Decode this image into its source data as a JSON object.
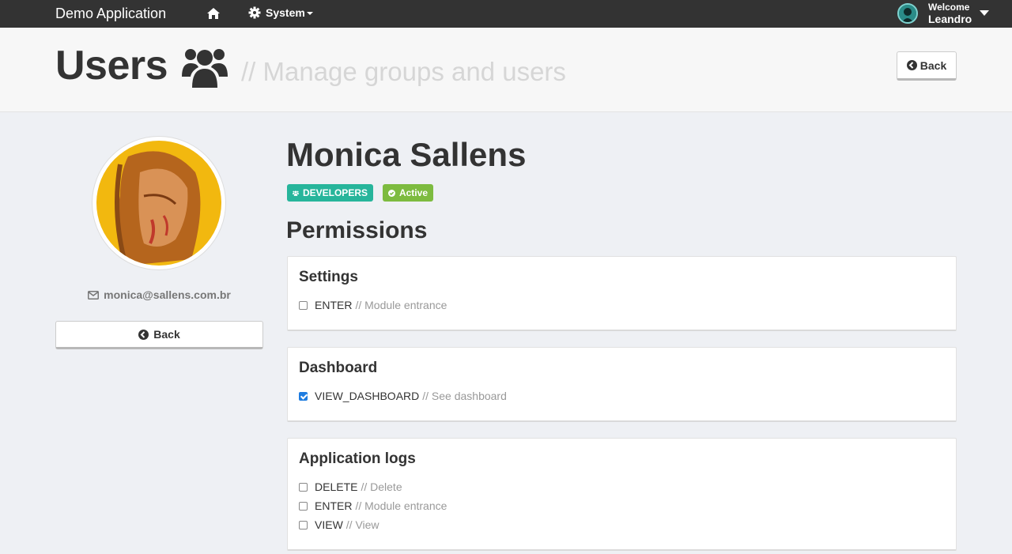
{
  "navbar": {
    "brand": "Demo Application",
    "home_icon": "home-icon",
    "system_icon": "gear-icon",
    "system_label": "System",
    "user": {
      "welcome": "Welcome",
      "name": "Leandro"
    }
  },
  "header": {
    "title": "Users",
    "title_icon": "users-icon",
    "subtitle": "// Manage groups and users",
    "back_label": "Back"
  },
  "profile": {
    "email": "monica@sallens.com.br",
    "back_label": "Back"
  },
  "user": {
    "name": "Monica Sallens",
    "group_badge": "DEVELOPERS",
    "status_badge": "Active"
  },
  "permissions": {
    "title": "Permissions",
    "sections": [
      {
        "title": "Settings",
        "items": [
          {
            "code": "ENTER",
            "desc": "// Module entrance",
            "checked": false
          }
        ]
      },
      {
        "title": "Dashboard",
        "items": [
          {
            "code": "VIEW_DASHBOARD",
            "desc": "// See dashboard",
            "checked": true
          }
        ]
      },
      {
        "title": "Application logs",
        "items": [
          {
            "code": "DELETE",
            "desc": "// Delete",
            "checked": false
          },
          {
            "code": "ENTER",
            "desc": "// Module entrance",
            "checked": false
          },
          {
            "code": "VIEW",
            "desc": "// View",
            "checked": false
          }
        ]
      }
    ]
  },
  "colors": {
    "navbar": "#333333",
    "group_badge": "#27b59b",
    "status_badge": "#7dbb3f",
    "checkbox_checked": "#1e7ce0"
  }
}
